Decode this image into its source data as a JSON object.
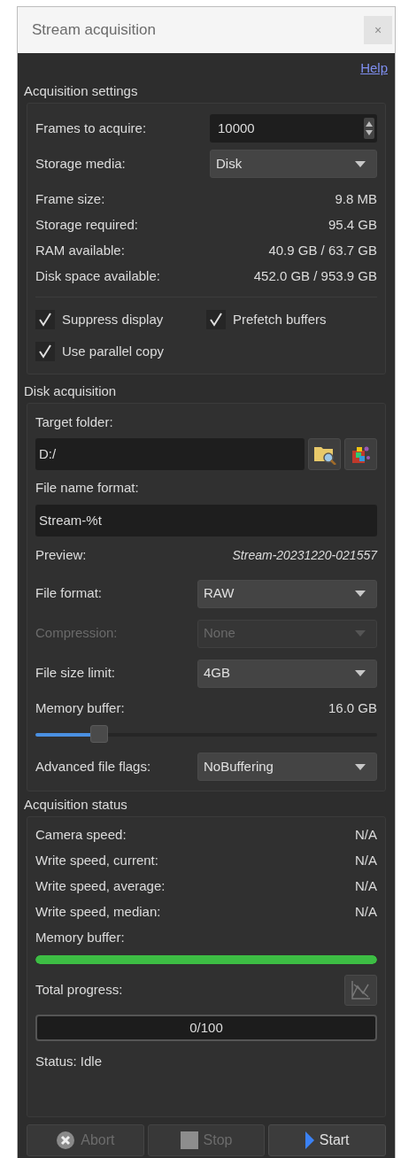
{
  "window": {
    "title": "Stream acquisition",
    "close": "×"
  },
  "help_link": "Help",
  "acquisition_settings": {
    "title": "Acquisition settings",
    "frames_to_acquire": {
      "label": "Frames to acquire:",
      "value": "10000"
    },
    "storage_media": {
      "label": "Storage media:",
      "value": "Disk",
      "disabled": false
    },
    "info_rows": [
      {
        "label": "Frame size:",
        "value": "9.8 MB"
      },
      {
        "label": "Storage required:",
        "value": "95.4 GB"
      },
      {
        "label": "RAM available:",
        "value": "40.9 GB / 63.7 GB"
      },
      {
        "label": "Disk space available:",
        "value": "452.0 GB / 953.9 GB"
      }
    ],
    "checkboxes": [
      {
        "label": "Suppress display",
        "checked": true
      },
      {
        "label": "Prefetch buffers",
        "checked": true
      },
      {
        "label": "Use parallel copy",
        "checked": true
      }
    ]
  },
  "disk_acquisition": {
    "title": "Disk acquisition",
    "target_folder": {
      "label": "Target folder:",
      "value": "D:/"
    },
    "file_name_format": {
      "label": "File name format:",
      "value": "Stream-%t"
    },
    "preview": {
      "label": "Preview:",
      "value": "Stream-20231220-021557"
    },
    "selects": [
      {
        "label": "File format:",
        "value": "RAW",
        "disabled": false
      },
      {
        "label": "Compression:",
        "value": "None",
        "disabled": true
      },
      {
        "label": "File size limit:",
        "value": "4GB",
        "disabled": false
      }
    ],
    "memory_buffer": {
      "label": "Memory buffer:",
      "reading": "16.0 GB",
      "level": 0.17
    },
    "advanced_file_flags": {
      "label": "Advanced file flags:",
      "value": "NoBuffering",
      "disabled": false
    }
  },
  "acquisition_status": {
    "title": "Acquisition status",
    "rows": [
      {
        "label": "Camera speed:",
        "value": "N/A"
      },
      {
        "label": "Write speed, current:",
        "value": "N/A"
      },
      {
        "label": "Write speed, average:",
        "value": "N/A"
      },
      {
        "label": "Write speed, median:",
        "value": "N/A"
      }
    ],
    "memory_buffer": {
      "label": "Memory buffer:",
      "level": 1
    },
    "total_progress": {
      "label": "Total progress:",
      "text": "0/100",
      "level": 0
    },
    "status": "Status: Idle"
  },
  "buttons": [
    {
      "label": "Abort",
      "kind": "abort",
      "disabled": true
    },
    {
      "label": "Stop",
      "kind": "stop",
      "disabled": true
    },
    {
      "label": "Start",
      "kind": "start",
      "disabled": false
    }
  ]
}
